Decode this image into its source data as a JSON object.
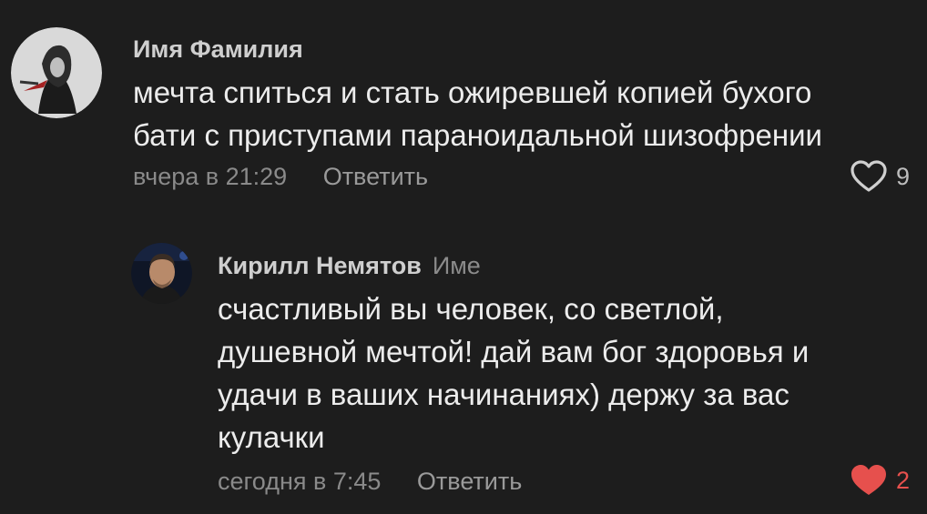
{
  "comments": [
    {
      "author": "Имя Фамилия",
      "lines": [
        "мечта спиться и стать ожиревшей копией бухого",
        "бати с приступами параноидальной шизофрении"
      ],
      "timestamp": "вчера в 21:29",
      "reply_label": "Ответить",
      "likes": "9",
      "liked": false,
      "like_icon": "heart-outline-icon"
    },
    {
      "author": "Кирилл Немятов",
      "reply_to": "Име",
      "lines": [
        "счастливый вы человек, со светлой,",
        "душевной мечтой! дай вам бог здоровья и",
        "удачи в ваших начинаниях) держу за вас",
        "кулачки"
      ],
      "timestamp": "сегодня в 7:45",
      "reply_label": "Ответить",
      "likes": "2",
      "liked": true,
      "like_icon": "heart-filled-icon"
    }
  ],
  "colors": {
    "background": "#1d1d1d",
    "liked": "#e6504d",
    "muted": "#8a8a8a"
  }
}
